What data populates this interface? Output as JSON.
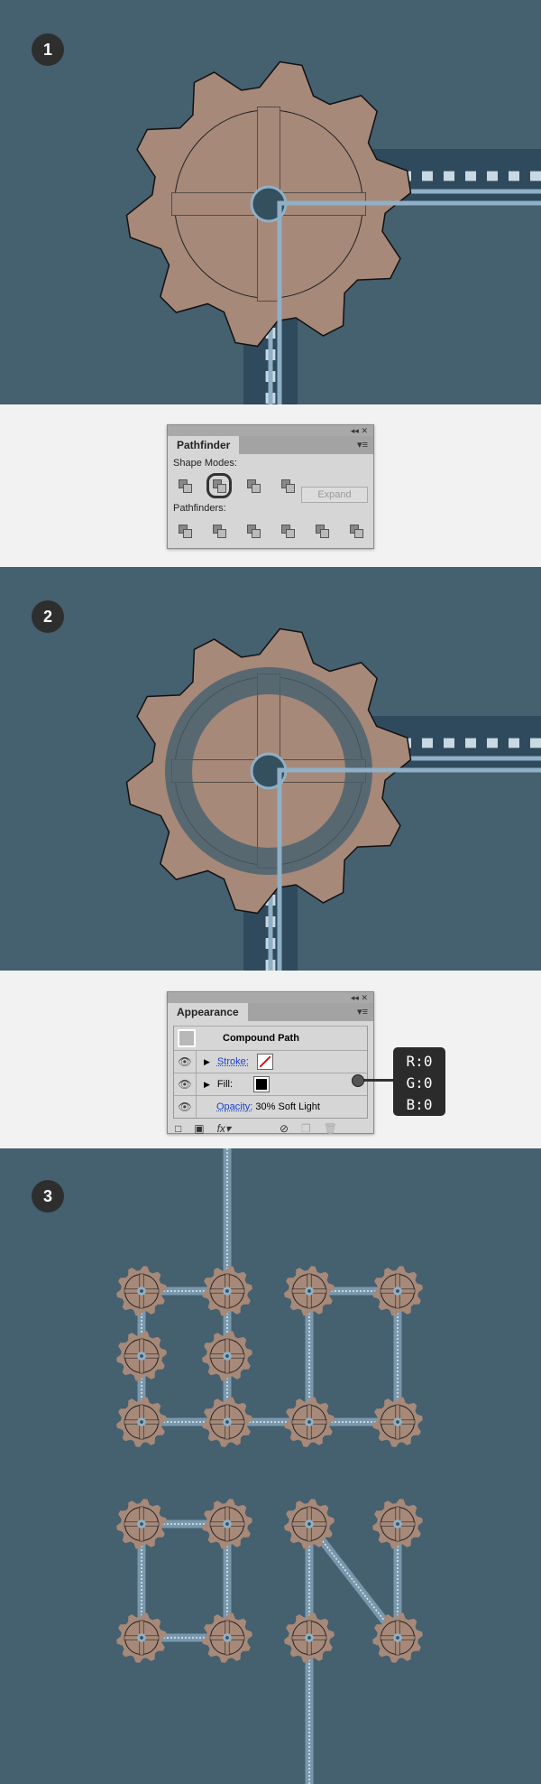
{
  "steps": [
    "1",
    "2",
    "3"
  ],
  "colors": {
    "background": "#45606f",
    "gear": "#a78979",
    "track": "#2f4a5c",
    "rail": "#8fb0c6",
    "dash": "#c8d9e4"
  },
  "pathfinder": {
    "title": "Pathfinder",
    "shape_modes_label": "Shape Modes:",
    "pathfinders_label": "Pathfinders:",
    "expand_label": "Expand",
    "shape_modes": [
      "unite-icon",
      "minus-front-icon",
      "intersect-icon",
      "exclude-icon"
    ],
    "pathfinder_tools": [
      "divide-icon",
      "trim-icon",
      "merge-icon",
      "crop-icon",
      "outline-icon",
      "minus-back-icon"
    ],
    "selected": "minus-front-icon"
  },
  "appearance": {
    "title": "Appearance",
    "object": "Compound Path",
    "stroke_label": "Stroke:",
    "fill_label": "Fill:",
    "opacity_label": "Opacity:",
    "opacity_value": "30% Soft Light",
    "stroke_swatch": "none",
    "fill_swatch": "#000000"
  },
  "callout": {
    "r": "R:0",
    "g": "G:0",
    "b": "B:0"
  },
  "panel_controls": {
    "collapse": "◂◂",
    "close": "✕",
    "menu": "▾≡"
  }
}
